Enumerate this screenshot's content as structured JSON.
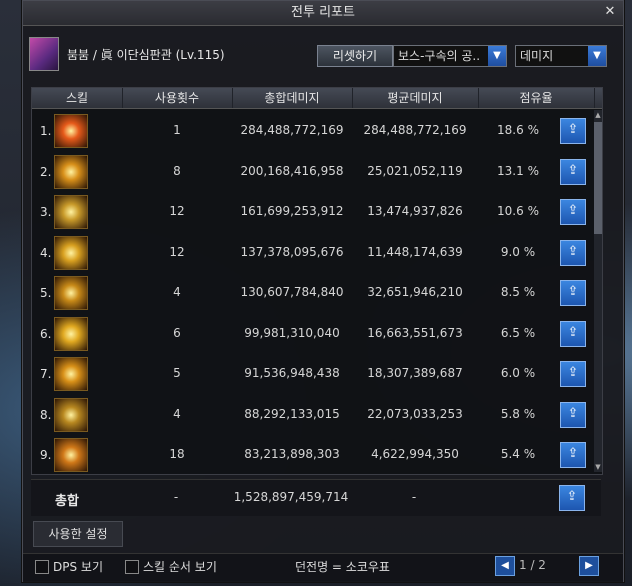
{
  "window": {
    "title": "전투 리포트",
    "close_label": "✕"
  },
  "character": {
    "name": "붐붐 / 眞 이단심판관 (Lv.115)"
  },
  "controls": {
    "reset_label": "리셋하기",
    "boss_filter": "보스-구속의 공..",
    "metric_select": "데미지"
  },
  "columns": [
    "스킬",
    "사용횟수",
    "총합데미지",
    "평균데미지",
    "점유율"
  ],
  "rows": [
    {
      "rank": "1.",
      "uses": "1",
      "total": "284,488,772,169",
      "avg": "284,488,772,169",
      "share": "18.6 %",
      "icon": "skill-flame-slash-icon",
      "color": "#e65a1a"
    },
    {
      "rank": "2.",
      "uses": "8",
      "total": "200,168,416,958",
      "avg": "25,021,052,119",
      "share": "13.1 %",
      "icon": "skill-whirlwind-icon",
      "color": "#d8901a"
    },
    {
      "rank": "3.",
      "uses": "12",
      "total": "161,699,253,912",
      "avg": "13,474,937,826",
      "share": "10.6 %",
      "icon": "skill-wave-icon",
      "color": "#c89a2a"
    },
    {
      "rank": "4.",
      "uses": "12",
      "total": "137,378,095,676",
      "avg": "11,448,174,639",
      "share": "9.0 %",
      "icon": "skill-spiral-icon",
      "color": "#d8a020"
    },
    {
      "rank": "5.",
      "uses": "4",
      "total": "130,607,784,840",
      "avg": "32,651,946,210",
      "share": "8.5 %",
      "icon": "skill-burst-icon",
      "color": "#c88a18"
    },
    {
      "rank": "6.",
      "uses": "6",
      "total": "99,981,310,040",
      "avg": "16,663,551,673",
      "share": "6.5 %",
      "icon": "skill-flare-icon",
      "color": "#e0a820"
    },
    {
      "rank": "7.",
      "uses": "5",
      "total": "91,536,948,438",
      "avg": "18,307,389,687",
      "share": "6.0 %",
      "icon": "skill-strike-icon",
      "color": "#d89018"
    },
    {
      "rank": "8.",
      "uses": "4",
      "total": "88,292,133,015",
      "avg": "22,073,033,253",
      "share": "5.8 %",
      "icon": "skill-gate-icon",
      "color": "#b88820"
    },
    {
      "rank": "9.",
      "uses": "18",
      "total": "83,213,898,303",
      "avg": "4,622,994,350",
      "share": "5.4 %",
      "icon": "skill-fire-pillar-icon",
      "color": "#d07818"
    }
  ],
  "total": {
    "label": "총합",
    "uses": "-",
    "total": "1,528,897,459,714",
    "avg": "-"
  },
  "used_settings_label": "사용한 설정",
  "bottom": {
    "dps_label": "DPS 보기",
    "skill_order_label": "스킬 순서 보기",
    "dungeon": "던전명 = 소코우표",
    "page": "1 / 2"
  }
}
